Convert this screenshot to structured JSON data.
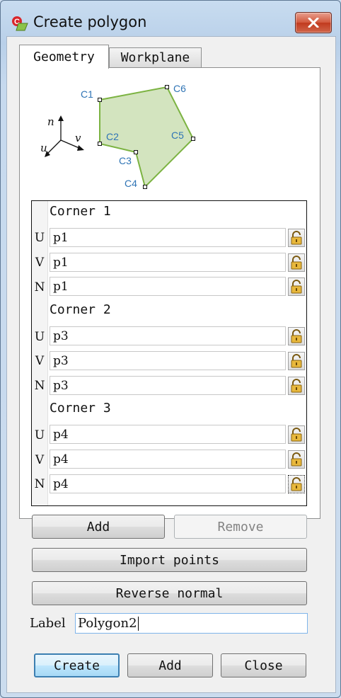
{
  "window": {
    "title": "Create polygon"
  },
  "tabs": [
    {
      "label": "Geometry",
      "active": true
    },
    {
      "label": "Workplane",
      "active": false
    }
  ],
  "diagram": {
    "corner_labels": [
      "C1",
      "C2",
      "C3",
      "C4",
      "C5",
      "C6"
    ],
    "axis_labels": {
      "n": "n",
      "u": "u",
      "v": "v"
    },
    "colors": {
      "fill": "#d3e4bf",
      "stroke": "#7cb342",
      "label": "#2f74b5"
    }
  },
  "corners": [
    {
      "header": "Corner 1",
      "rows": [
        {
          "axis": "U",
          "value": "p1"
        },
        {
          "axis": "V",
          "value": "p1"
        },
        {
          "axis": "N",
          "value": "p1"
        }
      ]
    },
    {
      "header": "Corner 2",
      "rows": [
        {
          "axis": "U",
          "value": "p3"
        },
        {
          "axis": "V",
          "value": "p3"
        },
        {
          "axis": "N",
          "value": "p3"
        }
      ]
    },
    {
      "header": "Corner 3",
      "rows": [
        {
          "axis": "U",
          "value": "p4"
        },
        {
          "axis": "V",
          "value": "p4"
        },
        {
          "axis": "N",
          "value": "p4"
        }
      ]
    }
  ],
  "buttons": {
    "add_corner": "Add",
    "remove_corner": "Remove",
    "import_points": "Import points",
    "reverse_normal": "Reverse normal"
  },
  "label_field": {
    "label": "Label",
    "value": "Polygon2"
  },
  "footer": {
    "create": "Create",
    "add": "Add",
    "close": "Close"
  },
  "icons": {
    "app": "create-polygon-app-icon",
    "lock": "lock-icon",
    "close": "close-icon"
  }
}
